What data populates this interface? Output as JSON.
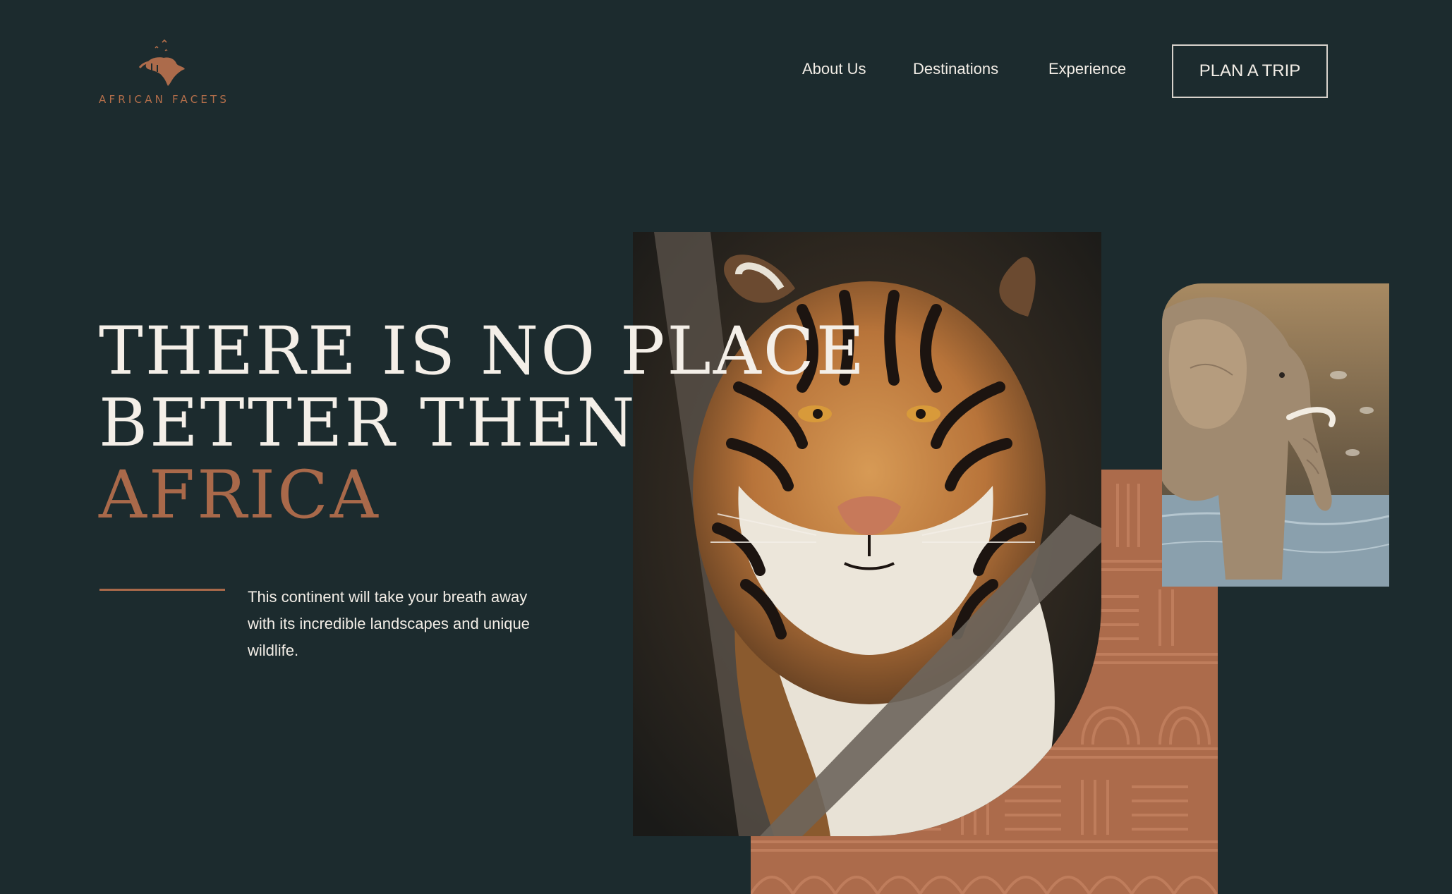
{
  "brand": {
    "name": "AFRICAN FACETS",
    "accent_color": "#ac6b4b",
    "background_color": "#1c2b2e"
  },
  "nav": {
    "items": [
      {
        "label": "About Us"
      },
      {
        "label": "Destinations"
      },
      {
        "label": "Experience"
      }
    ],
    "cta_label": "PLAN A TRIP"
  },
  "hero": {
    "headline_line1": "THERE IS NO PLACE",
    "headline_line2": "BETTER THEN",
    "headline_accent": "AFRICA",
    "tagline": "This continent will take your breath away with its incredible landscapes and unique wildlife."
  },
  "images": {
    "main_photo": "tiger-photo",
    "side_photo": "elephant-photo",
    "decor": "tribal-pattern"
  }
}
